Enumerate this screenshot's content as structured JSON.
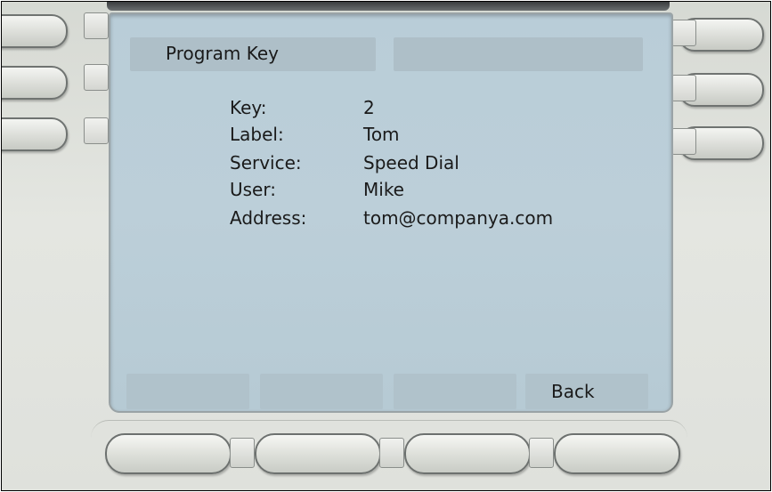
{
  "screen": {
    "title": "Program Key",
    "fields": [
      {
        "label": "Key:",
        "value": "2"
      },
      {
        "label": "Label:",
        "value": "Tom"
      },
      {
        "label": "Service:",
        "value": "Speed Dial"
      },
      {
        "label": "User:",
        "value": "Mike"
      },
      {
        "label": "Address:",
        "value": "tom@companya.com"
      }
    ],
    "softkeys": [
      "",
      "",
      "",
      "Back"
    ]
  },
  "icons": {
    "line_keys": "rounded-button",
    "soft_keys": "rounded-button"
  },
  "colors": {
    "screen_bg": "#bccfd9",
    "bezel": "#e0e2dd"
  }
}
